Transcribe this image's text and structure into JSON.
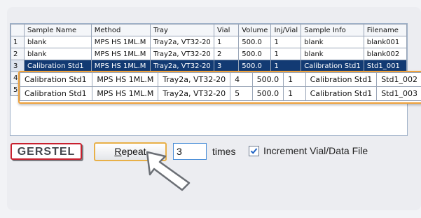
{
  "table": {
    "headers": [
      "",
      "Sample Name",
      "Method",
      "Tray",
      "Vial",
      "Volume",
      "Inj/Vial",
      "Sample Info",
      "Filename"
    ],
    "rows": [
      {
        "idx": "1",
        "cells": [
          "blank",
          "MPS HS 1ML.M",
          "Tray2a, VT32-20",
          "1",
          "500.0",
          "1",
          "blank",
          "blank001"
        ]
      },
      {
        "idx": "2",
        "cells": [
          "blank",
          "MPS HS 1ML.M",
          "Tray2a, VT32-20",
          "2",
          "500.0",
          "1",
          "blank",
          "blank002"
        ]
      },
      {
        "idx": "3",
        "cells": [
          "Calibration Std1",
          "MPS HS 1ML.M",
          "Tray2a, VT32-20",
          "3",
          "500.0",
          "1",
          "Calibration Std1",
          "Std1_001"
        ],
        "selected": true
      },
      {
        "idx": "4",
        "cells": []
      },
      {
        "idx": "5",
        "cells": []
      }
    ]
  },
  "popout_rows": [
    {
      "cells": [
        "Calibration Std1",
        "MPS HS 1ML.M",
        "Tray2a, VT32-20",
        "4",
        "500.0",
        "1",
        "Calibration Std1",
        "Std1_002"
      ]
    },
    {
      "cells": [
        "Calibration Std1",
        "MPS HS 1ML.M",
        "Tray2a, VT32-20",
        "5",
        "500.0",
        "1",
        "Calibration Std1",
        "Std1_003"
      ]
    }
  ],
  "logo_text": "GERSTEL",
  "repeat_button": {
    "label": "Repeat",
    "underline_char": "R",
    "rest": "epeat"
  },
  "times_input_value": "3",
  "times_label": "times",
  "increment_checkbox": {
    "label": "Increment Vial/Data File",
    "checked": true
  },
  "colors": {
    "selection": "#123a73",
    "highlight": "#f0a23a",
    "logo_red": "#c8202e"
  },
  "icons": {
    "cursor": "arrow-pointer-icon",
    "check": "check-mark-icon"
  }
}
